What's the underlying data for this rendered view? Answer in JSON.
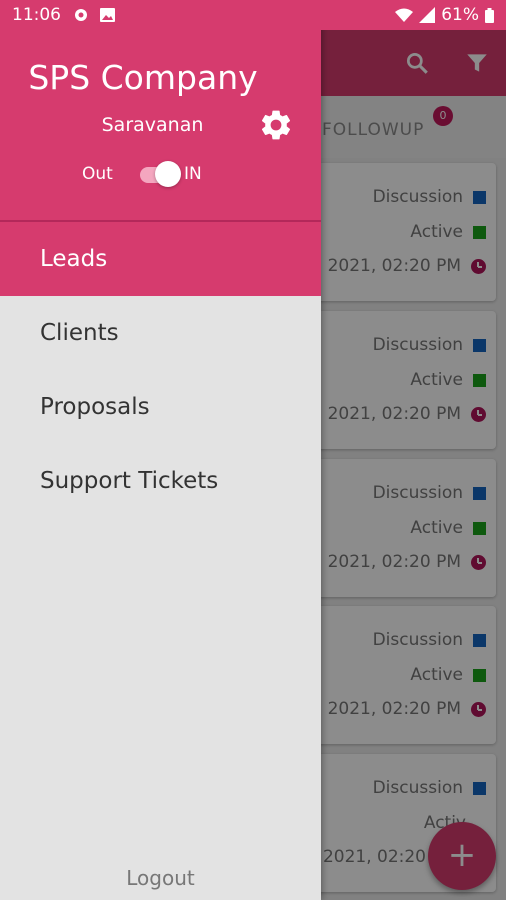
{
  "status_bar": {
    "time": "11:06",
    "battery": "61%"
  },
  "drawer": {
    "company": "SPS Company",
    "user": "Saravanan",
    "switch": {
      "off_label": "Out",
      "on_label": "IN",
      "state": "on"
    },
    "menu": [
      {
        "label": "Leads",
        "active": true
      },
      {
        "label": "Clients",
        "active": false
      },
      {
        "label": "Proposals",
        "active": false
      },
      {
        "label": "Support Tickets",
        "active": false
      }
    ],
    "logout": "Logout"
  },
  "background": {
    "tab_label": "FOLLOWUP",
    "badge": "0",
    "cards": [
      {
        "type": "Discussion",
        "status": "Active",
        "time": "2021, 02:20 PM"
      },
      {
        "type": "Discussion",
        "status": "Active",
        "time": "2021, 02:20 PM"
      },
      {
        "type": "Discussion",
        "status": "Active",
        "time": "2021, 02:20 PM"
      },
      {
        "type": "Discussion",
        "status": "Active",
        "time": "2021, 02:20 PM"
      },
      {
        "type": "Discussion",
        "status": "Activ",
        "time": "2021, 02:20"
      }
    ]
  },
  "colors": {
    "brand": "#d63b6e",
    "discussion": "#1565c0",
    "active": "#1aa31a",
    "clock": "#b0155a"
  }
}
